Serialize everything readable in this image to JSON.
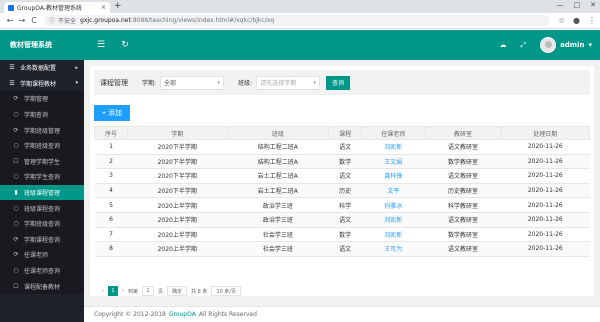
{
  "browser": {
    "tab_title": "GroupOA-教材管理系统",
    "tab_close": "×",
    "new_tab": "+",
    "win_controls": [
      "—",
      "□",
      "✕"
    ],
    "nav": [
      "←",
      "→",
      "C"
    ],
    "security_label": "不安全",
    "host": "gxjc.groupoa.net",
    "path": ":8088/teaching/views/index.html#/xqkc/bjkc/xq",
    "right_icons": [
      "☆",
      "●",
      "⋮"
    ]
  },
  "header": {
    "brand": "教材管理系统",
    "menu_icon": "☰",
    "refresh_icon": "↻",
    "icons": [
      "☁",
      "⤢"
    ],
    "user": "admin",
    "user_caret": "▾"
  },
  "sidebar": {
    "items": [
      {
        "label": "业务数据配置",
        "icon": "☰",
        "arrow": "▸",
        "kind": "top"
      },
      {
        "label": "学期课程教材",
        "icon": "☰",
        "arrow": "▾",
        "kind": "top"
      },
      {
        "label": "学期管理",
        "icon": "⟳",
        "kind": "sub"
      },
      {
        "label": "学期查询",
        "icon": "○",
        "kind": "sub"
      },
      {
        "label": "学期班级管理",
        "icon": "⟳",
        "kind": "sub"
      },
      {
        "label": "学期班级查询",
        "icon": "○",
        "kind": "sub"
      },
      {
        "label": "管理学期学生",
        "icon": "☐",
        "kind": "sub"
      },
      {
        "label": "学期学生查询",
        "icon": "○",
        "kind": "sub"
      },
      {
        "label": "班级课程管理",
        "icon": "▮",
        "kind": "sub active"
      },
      {
        "label": "班级课程查询",
        "icon": "○",
        "kind": "sub"
      },
      {
        "label": "学期班级查询",
        "icon": "○",
        "kind": "sub"
      },
      {
        "label": "学期课程查询",
        "icon": "⟳",
        "kind": "sub"
      },
      {
        "label": "任课老师",
        "icon": "⟳",
        "kind": "sub"
      },
      {
        "label": "任课老师查询",
        "icon": "○",
        "kind": "sub"
      },
      {
        "label": "课程配备教材",
        "icon": "☐",
        "kind": "sub"
      }
    ]
  },
  "filter": {
    "title": "课程管理",
    "semester_label": "学期:",
    "semester_value": "全部",
    "class_label": "班级:",
    "class_placeholder": "请先选择学期",
    "search_label": "查询",
    "caret": "▾"
  },
  "add_button": "+ 添加",
  "table": {
    "headers": [
      "序号",
      "学期",
      "班级",
      "课程",
      "任课老师",
      "教研室",
      "处理日期"
    ],
    "rows": [
      [
        "1",
        "2020下半学期",
        "结构工程二班A",
        "语文",
        "刘凯新",
        "语文教研室",
        "2020-11-26"
      ],
      [
        "2",
        "2020下半学期",
        "结构工程二班A",
        "数学",
        "王文娟",
        "数学教研室",
        "2020-11-26"
      ],
      [
        "3",
        "2020下半学期",
        "岩土工程二班A",
        "语文",
        "龚梓锋",
        "语文教研室",
        "2020-11-26"
      ],
      [
        "4",
        "2020下半学期",
        "岩土工程二班A",
        "历史",
        "文平",
        "历史教研室",
        "2020-11-26"
      ],
      [
        "5",
        "2020上半学期",
        "政治学三班",
        "科学",
        "何雅冰",
        "科学教研室",
        "2020-11-26"
      ],
      [
        "6",
        "2020上半学期",
        "政治学三班",
        "语文",
        "刘凯新",
        "语文教研室",
        "2020-11-26"
      ],
      [
        "7",
        "2020上半学期",
        "社会学三班",
        "数学",
        "刘凯新",
        "数学教研室",
        "2020-11-26"
      ],
      [
        "8",
        "2020上半学期",
        "社会学三班",
        "语文",
        "王可为",
        "语文教研室",
        "2020-11-26"
      ]
    ]
  },
  "pager": {
    "prev": "‹",
    "current": "1",
    "next": "›",
    "goto_label": "到第",
    "goto_value": "1",
    "page_unit": "页",
    "confirm": "确定",
    "total": "共 8 条",
    "per_page": "10 条/页"
  },
  "footer": {
    "copyright": "Copyright © 2012-2018",
    "org": "GroupOA",
    "rights": "All Rights Reserved"
  }
}
